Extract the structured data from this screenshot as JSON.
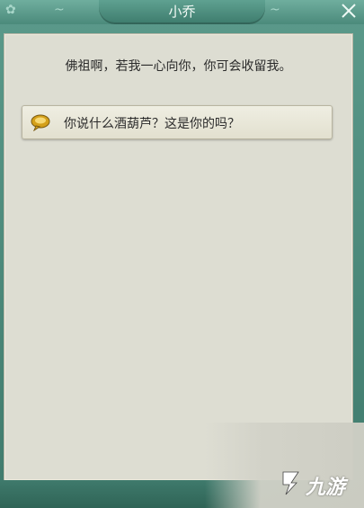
{
  "dialog": {
    "title": "小乔",
    "message": "佛祖啊，若我一心向你，你可会收留我。",
    "options": [
      {
        "label": "你说什么酒葫芦？这是你的吗？",
        "icon": "speech-bubble-icon"
      }
    ],
    "close_icon": "close-icon"
  },
  "watermark": {
    "text": "九游",
    "icon": "watermark-logo-icon"
  },
  "colors": {
    "frame": "#4d8a7c",
    "panel": "#ddddd2",
    "option_bg": "#e6e4d6",
    "text": "#2b2b2b",
    "speech_icon": "#d4a01a"
  }
}
